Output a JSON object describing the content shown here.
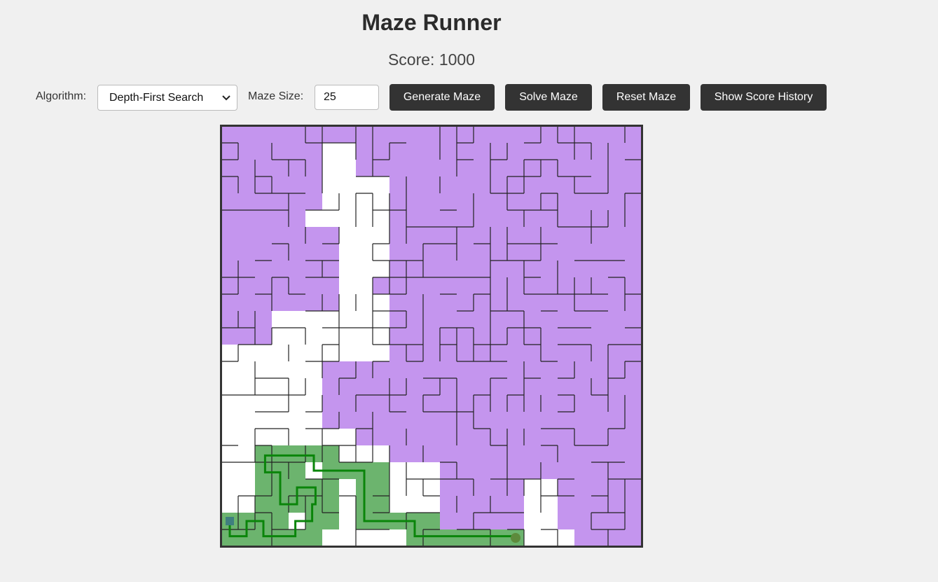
{
  "title": "Maze Runner",
  "score": {
    "label": "Score:",
    "value": "1000"
  },
  "controls": {
    "algorithm_label": "Algorithm:",
    "algorithm_selected": "Depth-First Search",
    "size_label": "Maze Size:",
    "size_value": "25"
  },
  "buttons": {
    "generate": "Generate Maze",
    "solve": "Solve Maze",
    "reset": "Reset Maze",
    "history": "Show Score History"
  },
  "maze": {
    "cols": 25,
    "rows": 25,
    "colors": {
      "visited": "#c495ee",
      "path_fill": "#6cb46e",
      "path_line": "#0a850a",
      "walls": "#222222",
      "border": "#333333",
      "open": "#ffffff",
      "start_marker": "#3f7f7f",
      "end_marker": "#5d8a3c"
    },
    "visited_rows": [
      "1111111111111111111111111",
      "1110000111111111111111111",
      "1110000111111111111111111",
      "1111111111111111111111111",
      "1111111111111111111111111",
      "1111111111111111111111111",
      "1111111111111111111111111",
      "1111111111111111111111111",
      "1111111111111111111111111",
      "1111111111111111111111111",
      "1111111111111111111111111",
      "1111111111111111111111111",
      "1111111111111111111111111",
      "1111111111111111111111111",
      "1111111111111111111111111",
      "0000000000111111111111111",
      "0000000000111111111111111",
      "0000000000111111111111111",
      "0000000000111111111111111",
      "0000000000111111111111111",
      "0000000000000111111111111",
      "0000000000000111111111111",
      "0000000000000111111111111",
      "0000000000000000111111111",
      "0000000000000000000001111"
    ],
    "visited_extra": [
      [
        0,
        7
      ],
      [
        1,
        7
      ],
      [
        2,
        7
      ],
      [
        3,
        7
      ],
      [
        0,
        8
      ],
      [
        1,
        8
      ],
      [
        2,
        8
      ],
      [
        3,
        8
      ],
      [
        4,
        8
      ],
      [
        5,
        8
      ],
      [
        6,
        8
      ],
      [
        7,
        8
      ],
      [
        8,
        8
      ],
      [
        9,
        8
      ],
      [
        0,
        9
      ],
      [
        1,
        9
      ],
      [
        2,
        9
      ],
      [
        3,
        9
      ],
      [
        4,
        9
      ],
      [
        5,
        9
      ],
      [
        6,
        9
      ],
      [
        0,
        10
      ],
      [
        1,
        10
      ],
      [
        2,
        10
      ],
      [
        3,
        10
      ],
      [
        4,
        10
      ],
      [
        5,
        10
      ],
      [
        6,
        10
      ],
      [
        0,
        11
      ],
      [
        1,
        11
      ],
      [
        2,
        11
      ],
      [
        3,
        11
      ],
      [
        4,
        11
      ],
      [
        5,
        11
      ],
      [
        6,
        11
      ],
      [
        0,
        12
      ],
      [
        1,
        12
      ],
      [
        2,
        12
      ],
      [
        0,
        13
      ],
      [
        1,
        13
      ],
      [
        2,
        13
      ],
      [
        0,
        14
      ],
      [
        1,
        14
      ],
      [
        2,
        14
      ],
      [
        4,
        12
      ],
      [
        5,
        12
      ],
      [
        6,
        12
      ],
      [
        7,
        12
      ],
      [
        8,
        12
      ],
      [
        9,
        12
      ],
      [
        9,
        13
      ],
      [
        10,
        13
      ],
      [
        11,
        13
      ],
      [
        12,
        13
      ],
      [
        13,
        13
      ],
      [
        14,
        13
      ],
      [
        15,
        13
      ],
      [
        16,
        13
      ],
      [
        17,
        13
      ],
      [
        18,
        13
      ],
      [
        19,
        13
      ],
      [
        20,
        13
      ],
      [
        21,
        13
      ],
      [
        22,
        13
      ],
      [
        23,
        13
      ],
      [
        24,
        13
      ]
    ],
    "unvisited_cells": [
      [
        6,
        1
      ],
      [
        7,
        1
      ],
      [
        6,
        2
      ],
      [
        7,
        2
      ],
      [
        6,
        3
      ],
      [
        7,
        3
      ],
      [
        8,
        3
      ],
      [
        9,
        3
      ],
      [
        6,
        4
      ],
      [
        7,
        4
      ],
      [
        8,
        4
      ],
      [
        9,
        4
      ],
      [
        5,
        5
      ],
      [
        6,
        5
      ],
      [
        7,
        5
      ],
      [
        8,
        5
      ],
      [
        9,
        5
      ],
      [
        7,
        6
      ],
      [
        8,
        6
      ],
      [
        9,
        6
      ],
      [
        7,
        7
      ],
      [
        8,
        7
      ],
      [
        9,
        7
      ],
      [
        7,
        8
      ],
      [
        8,
        8
      ],
      [
        9,
        8
      ],
      [
        7,
        9
      ],
      [
        8,
        9
      ],
      [
        3,
        11
      ],
      [
        4,
        11
      ],
      [
        5,
        11
      ],
      [
        6,
        11
      ],
      [
        7,
        11
      ],
      [
        8,
        11
      ],
      [
        9,
        11
      ],
      [
        7,
        10
      ],
      [
        8,
        10
      ],
      [
        9,
        10
      ],
      [
        3,
        12
      ],
      [
        4,
        12
      ],
      [
        5,
        12
      ],
      [
        6,
        12
      ],
      [
        7,
        12
      ],
      [
        8,
        12
      ],
      [
        9,
        12
      ],
      [
        0,
        13
      ],
      [
        1,
        13
      ],
      [
        2,
        13
      ],
      [
        3,
        13
      ],
      [
        4,
        13
      ],
      [
        5,
        13
      ],
      [
        6,
        13
      ],
      [
        7,
        13
      ],
      [
        8,
        13
      ],
      [
        9,
        13
      ],
      [
        0,
        14
      ],
      [
        1,
        14
      ],
      [
        2,
        14
      ],
      [
        3,
        14
      ],
      [
        4,
        14
      ],
      [
        5,
        14
      ],
      [
        0,
        15
      ],
      [
        1,
        15
      ],
      [
        2,
        15
      ],
      [
        3,
        15
      ],
      [
        4,
        15
      ],
      [
        5,
        15
      ],
      [
        0,
        16
      ],
      [
        1,
        16
      ],
      [
        2,
        16
      ],
      [
        3,
        16
      ],
      [
        4,
        16
      ],
      [
        5,
        16
      ],
      [
        0,
        17
      ],
      [
        1,
        17
      ],
      [
        2,
        17
      ],
      [
        3,
        17
      ],
      [
        4,
        17
      ],
      [
        5,
        17
      ],
      [
        0,
        18
      ],
      [
        1,
        18
      ],
      [
        2,
        18
      ],
      [
        3,
        18
      ],
      [
        4,
        18
      ],
      [
        5,
        18
      ],
      [
        6,
        18
      ],
      [
        7,
        18
      ],
      [
        8,
        18
      ],
      [
        9,
        18
      ],
      [
        0,
        19
      ],
      [
        1,
        19
      ],
      [
        2,
        19
      ],
      [
        3,
        19
      ],
      [
        4,
        19
      ],
      [
        5,
        19
      ],
      [
        6,
        19
      ],
      [
        7,
        19
      ],
      [
        8,
        19
      ],
      [
        9,
        19
      ],
      [
        10,
        19
      ]
    ],
    "path_cells": [
      [
        2,
        19
      ],
      [
        3,
        19
      ],
      [
        4,
        19
      ],
      [
        5,
        19
      ],
      [
        6,
        19
      ],
      [
        2,
        20
      ],
      [
        3,
        20
      ],
      [
        4,
        20
      ],
      [
        6,
        20
      ],
      [
        7,
        20
      ],
      [
        8,
        20
      ],
      [
        9,
        20
      ],
      [
        2,
        21
      ],
      [
        3,
        21
      ],
      [
        4,
        21
      ],
      [
        5,
        21
      ],
      [
        6,
        21
      ],
      [
        8,
        21
      ],
      [
        9,
        21
      ],
      [
        2,
        22
      ],
      [
        3,
        22
      ],
      [
        4,
        22
      ],
      [
        5,
        22
      ],
      [
        6,
        22
      ],
      [
        8,
        22
      ],
      [
        9,
        22
      ],
      [
        0,
        23
      ],
      [
        1,
        23
      ],
      [
        2,
        23
      ],
      [
        3,
        23
      ],
      [
        5,
        23
      ],
      [
        6,
        23
      ],
      [
        8,
        23
      ],
      [
        9,
        23
      ],
      [
        10,
        23
      ],
      [
        11,
        23
      ],
      [
        12,
        23
      ],
      [
        0,
        24
      ],
      [
        1,
        24
      ],
      [
        2,
        24
      ],
      [
        3,
        24
      ],
      [
        4,
        24
      ],
      [
        5,
        24
      ],
      [
        11,
        24
      ],
      [
        12,
        24
      ],
      [
        13,
        24
      ],
      [
        14,
        24
      ],
      [
        15,
        24
      ],
      [
        16,
        24
      ],
      [
        17,
        24
      ]
    ],
    "path_polyline": [
      [
        0.5,
        23.5
      ],
      [
        0.5,
        24.4
      ],
      [
        1.5,
        24.4
      ],
      [
        1.5,
        23.5
      ],
      [
        2.5,
        23.5
      ],
      [
        2.5,
        24.4
      ],
      [
        4.4,
        24.4
      ],
      [
        4.4,
        23.5
      ],
      [
        5.4,
        23.5
      ],
      [
        5.4,
        22.5
      ],
      [
        5.6,
        22.5
      ],
      [
        5.6,
        21.5
      ],
      [
        4.5,
        21.5
      ],
      [
        4.5,
        22.5
      ],
      [
        3.5,
        22.5
      ],
      [
        3.5,
        20.6
      ],
      [
        2.6,
        20.6
      ],
      [
        2.6,
        19.6
      ],
      [
        5.5,
        19.6
      ],
      [
        5.5,
        20.5
      ],
      [
        8.5,
        20.5
      ],
      [
        8.5,
        23.5
      ],
      [
        11.5,
        23.5
      ],
      [
        11.5,
        24.4
      ],
      [
        17.5,
        24.4
      ]
    ],
    "start_cell": [
      0,
      23
    ],
    "end_cell": [
      17,
      24
    ]
  }
}
